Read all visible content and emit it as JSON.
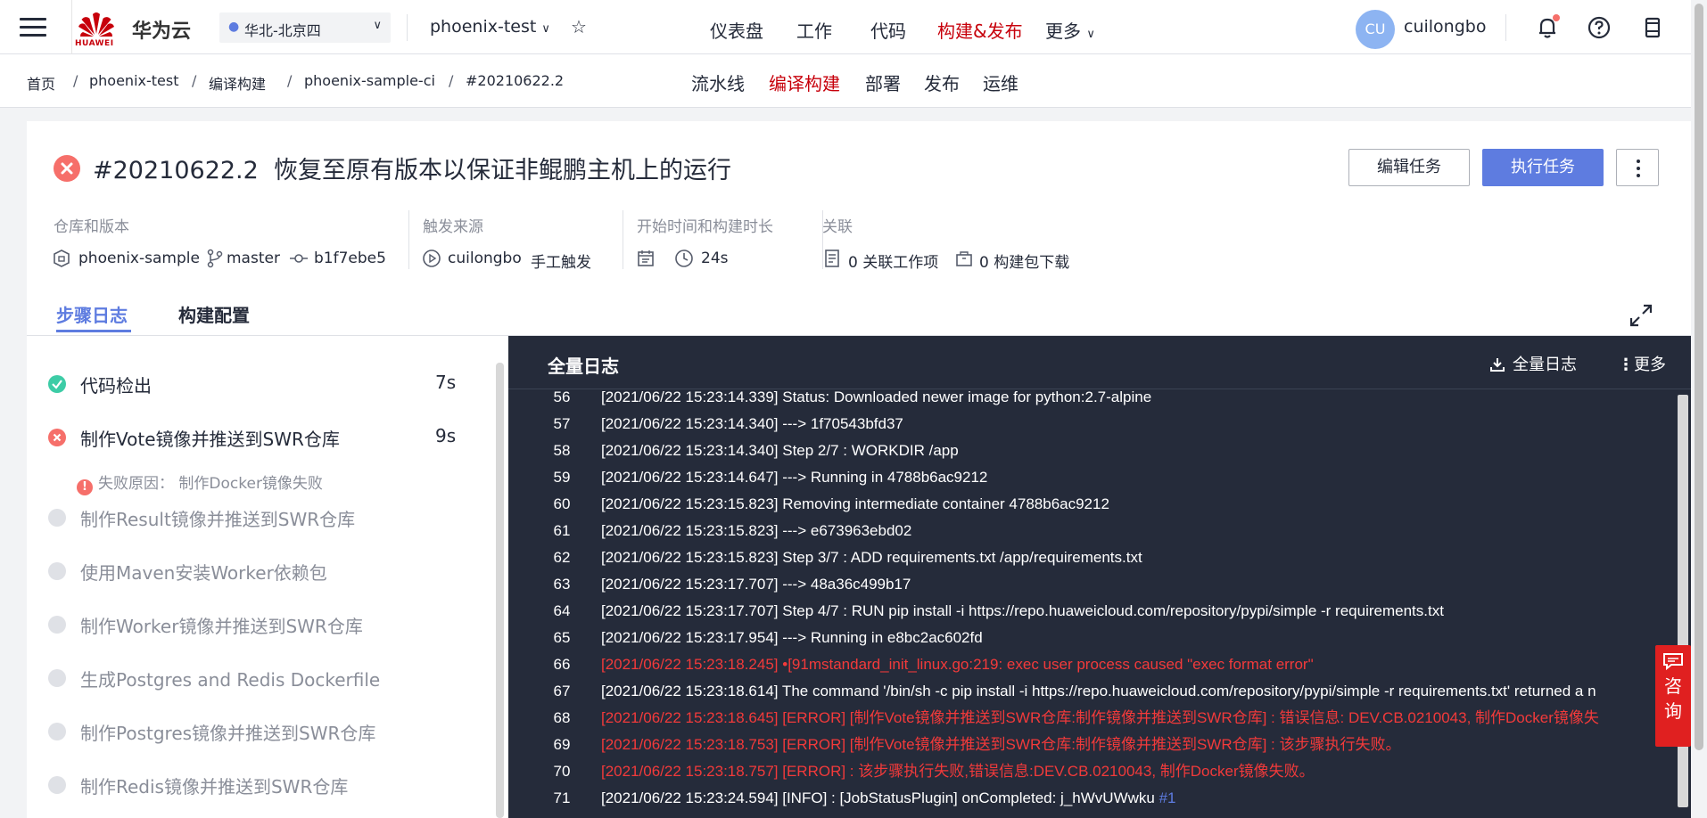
{
  "header": {
    "brand": "华为云",
    "logo_text": "HUAWEI",
    "region": "华北-北京四",
    "project": "phoenix-test",
    "nav": [
      "仪表盘",
      "工作",
      "代码",
      "构建&发布",
      "更多"
    ],
    "active_nav": "构建&发布",
    "avatar_initials": "CU",
    "username": "cuilongbo"
  },
  "breadcrumb": {
    "items": [
      "首页",
      "phoenix-test",
      "编译构建",
      "phoenix-sample-ci",
      "#20210622.2"
    ],
    "separator": "/"
  },
  "subnav": {
    "items": [
      "流水线",
      "编译构建",
      "部署",
      "发布",
      "运维"
    ],
    "active": "编译构建"
  },
  "build": {
    "number": "#20210622.2",
    "title": "恢复至原有版本以保证非鲲鹏主机上的运行",
    "status": "failed",
    "edit_label": "编辑任务",
    "run_label": "执行任务"
  },
  "meta": {
    "repo_heading": "仓库和版本",
    "repo": "phoenix-sample",
    "branch": "master",
    "commit": "b1f7ebe5",
    "trigger_heading": "触发来源",
    "trigger_user": "cuilongbo",
    "trigger_type": "手工触发",
    "time_heading": "开始时间和构建时长",
    "duration": "24s",
    "link_heading": "关联",
    "work_items": "0 关联工作项",
    "packages": "0 构建包下载"
  },
  "tabs": [
    "步骤日志",
    "构建配置"
  ],
  "steps": [
    {
      "name": "代码检出",
      "time": "7s",
      "status": "success"
    },
    {
      "name": "制作Vote镜像并推送到SWR仓库",
      "time": "9s",
      "status": "failed"
    },
    {
      "name": "制作Result镜像并推送到SWR仓库",
      "time": "",
      "status": "pending"
    },
    {
      "name": "使用Maven安装Worker依赖包",
      "time": "",
      "status": "pending"
    },
    {
      "name": "制作Worker镜像并推送到SWR仓库",
      "time": "",
      "status": "pending"
    },
    {
      "name": "生成Postgres and Redis Dockerfile",
      "time": "",
      "status": "pending"
    },
    {
      "name": "制作Postgres镜像并推送到SWR仓库",
      "time": "",
      "status": "pending"
    },
    {
      "name": "制作Redis镜像并推送到SWR仓库",
      "time": "",
      "status": "pending"
    }
  ],
  "failure_reason": "失败原因： 制作Docker镜像失败",
  "log": {
    "title": "全量日志",
    "download_label": "全量日志",
    "more_label": "更多",
    "lines": [
      {
        "n": "56",
        "text": "[2021/06/22 15:23:14.339] Status: Downloaded newer image for python:2.7-alpine",
        "level": "info"
      },
      {
        "n": "57",
        "text": "[2021/06/22 15:23:14.340]  ---> 1f70543bfd37",
        "level": "info"
      },
      {
        "n": "58",
        "text": "[2021/06/22 15:23:14.340] Step 2/7 : WORKDIR /app",
        "level": "info"
      },
      {
        "n": "59",
        "text": "[2021/06/22 15:23:14.647]  ---> Running in 4788b6ac9212",
        "level": "info"
      },
      {
        "n": "60",
        "text": "[2021/06/22 15:23:15.823] Removing intermediate container 4788b6ac9212",
        "level": "info"
      },
      {
        "n": "61",
        "text": "[2021/06/22 15:23:15.823]  ---> e673963ebd02",
        "level": "info"
      },
      {
        "n": "62",
        "text": "[2021/06/22 15:23:15.823] Step 3/7 : ADD requirements.txt /app/requirements.txt",
        "level": "info"
      },
      {
        "n": "63",
        "text": "[2021/06/22 15:23:17.707]  ---> 48a36c499b17",
        "level": "info"
      },
      {
        "n": "64",
        "text": "[2021/06/22 15:23:17.707] Step 4/7 : RUN pip install -i https://repo.huaweicloud.com/repository/pypi/simple -r requirements.txt",
        "level": "info"
      },
      {
        "n": "65",
        "text": "[2021/06/22 15:23:17.954]  ---> Running in e8bc2ac602fd",
        "level": "info"
      },
      {
        "n": "66",
        "text": "[2021/06/22 15:23:18.245] •[91mstandard_init_linux.go:219: exec user process caused \"exec format error\"",
        "level": "error"
      },
      {
        "n": "67",
        "text": "[2021/06/22 15:23:18.614] The command '/bin/sh -c pip install -i https://repo.huaweicloud.com/repository/pypi/simple -r requirements.txt' returned a n",
        "level": "info"
      },
      {
        "n": "68",
        "text": "[2021/06/22 15:23:18.645] [ERROR] [制作Vote镜像并推送到SWR仓库:制作镜像并推送到SWR仓库] : 错误信息: DEV.CB.0210043, 制作Docker镜像失",
        "level": "error"
      },
      {
        "n": "69",
        "text": "[2021/06/22 15:23:18.753] [ERROR] [制作Vote镜像并推送到SWR仓库:制作镜像并推送到SWR仓库] : 该步骤执行失败。",
        "level": "error"
      },
      {
        "n": "70",
        "text": "[2021/06/22 15:23:18.757] [ERROR]  : 该步骤执行失败,错误信息:DEV.CB.0210043, 制作Docker镜像失败。",
        "level": "error"
      },
      {
        "n": "71",
        "text": "[2021/06/22 15:23:24.594] [INFO]  : [JobStatusPlugin] onCompleted: j_hWvUWwku ",
        "level": "info",
        "link": "#1"
      }
    ]
  },
  "consult": {
    "chars": [
      "咨",
      "询"
    ]
  },
  "colors": {
    "accent": "#5e7ce0",
    "brand_red": "#c7000b",
    "error": "#f66f6a",
    "success": "#3dcca6",
    "log_bg": "#252b3a"
  }
}
